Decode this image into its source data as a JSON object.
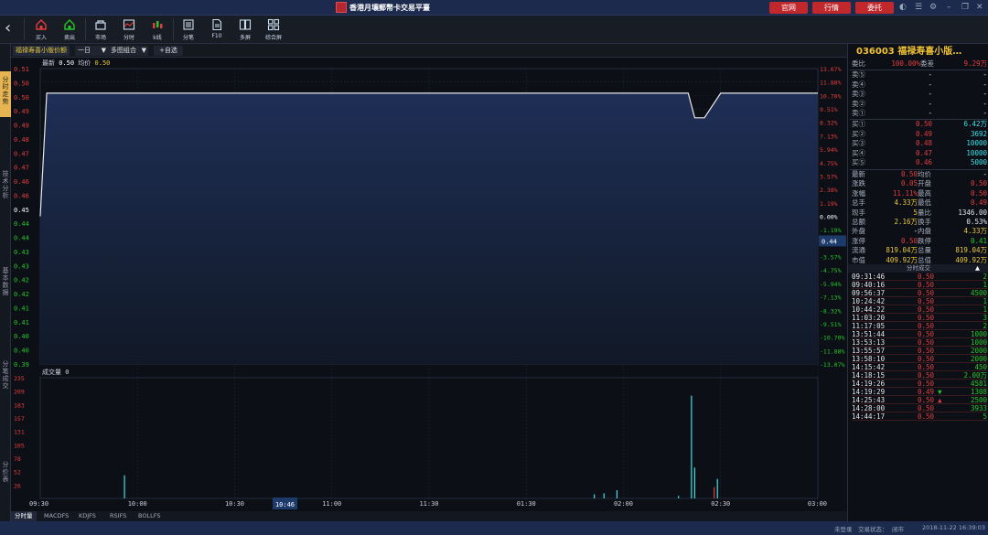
{
  "title": "香港月壤郵幣卡交易平臺",
  "top_buttons": [
    "官网",
    "行情",
    "委托"
  ],
  "toolbar": [
    {
      "label": "买入",
      "icon": "buy-icon"
    },
    {
      "label": "卖出",
      "icon": "sell-icon"
    },
    {
      "label": "市场",
      "icon": "market-icon"
    },
    {
      "label": "分时",
      "icon": "intraday-icon"
    },
    {
      "label": "k线",
      "icon": "kline-icon"
    },
    {
      "label": "分笔",
      "icon": "ticks-icon"
    },
    {
      "label": "F10",
      "icon": "f10-icon"
    },
    {
      "label": "多屏",
      "icon": "multiscreen-icon"
    },
    {
      "label": "综合屏",
      "icon": "overview-icon"
    }
  ],
  "side_tabs": [
    "分时走势",
    "技术分析",
    "基本数据",
    "分笔成交",
    "分价表"
  ],
  "chart_head": {
    "name": "福禄寿喜小版价额",
    "period": "一日",
    "combo": "多图组合",
    "add_fav": "+自选"
  },
  "price_legend": {
    "latest_label": "最新",
    "latest": "0.50",
    "avg_label": "均价",
    "avg": "0.50"
  },
  "volume_legend": {
    "label": "成交量",
    "value": "0"
  },
  "time_cursor": "10:46",
  "bottom_tabs": [
    "分时量",
    "MACDFS",
    "KDJFS",
    "RSIFS",
    "BOLLFS"
  ],
  "status": {
    "login": "未登录",
    "trade_state_label": "交易状态：",
    "trade_state": "闭市",
    "datetime": "2018-11-22 16:39:03"
  },
  "chart_data": {
    "type": "line",
    "prev_close": 0.45,
    "price_axis": [
      "0.51",
      "0.50",
      "0.50",
      "0.49",
      "0.49",
      "0.48",
      "0.47",
      "0.47",
      "0.46",
      "0.46",
      "0.45",
      "0.44",
      "0.44",
      "0.43",
      "0.43",
      "0.42",
      "0.42",
      "0.41",
      "0.41",
      "0.40",
      "0.40",
      "0.39"
    ],
    "pct_axis": [
      "13.07%",
      "11.88%",
      "10.70%",
      "9.51%",
      "8.32%",
      "7.13%",
      "5.94%",
      "4.75%",
      "3.57%",
      "2.38%",
      "1.19%",
      "0.00%",
      "-1.19%",
      "-2.38%",
      "-3.57%",
      "-4.75%",
      "-5.94%",
      "-7.13%",
      "-8.32%",
      "-9.51%",
      "-10.70%",
      "-11.88%",
      "-13.07%"
    ],
    "y_range": [
      0.39,
      0.51
    ],
    "cursor_price": "0.44",
    "x_ticks": [
      "09:30",
      "10:00",
      "10:30",
      "11:00",
      "11:30",
      "01:30",
      "02:00",
      "02:30",
      "03:00"
    ],
    "price_series": {
      "x": [
        0,
        2,
        200,
        202,
        205,
        210,
        240
      ],
      "y": [
        0.45,
        0.5,
        0.5,
        0.49,
        0.49,
        0.5,
        0.5
      ]
    },
    "volume_axis": [
      "235",
      "209",
      "183",
      "157",
      "131",
      "105",
      "78",
      "52",
      "26"
    ],
    "volume_range": [
      0,
      235
    ],
    "volume_bars": [
      {
        "x": 26,
        "v": 45,
        "c": "#3ce0e8"
      },
      {
        "x": 171,
        "v": 8,
        "c": "#3ce0e8"
      },
      {
        "x": 174,
        "v": 10,
        "c": "#3ce0e8"
      },
      {
        "x": 178,
        "v": 16,
        "c": "#3ce0e8"
      },
      {
        "x": 197,
        "v": 5,
        "c": "#3ce0e8"
      },
      {
        "x": 201,
        "v": 200,
        "c": "#3ce0e8"
      },
      {
        "x": 202,
        "v": 60,
        "c": "#3ce0e8"
      },
      {
        "x": 208,
        "v": 22,
        "c": "#e33d3d"
      },
      {
        "x": 209,
        "v": 38,
        "c": "#3ce0e8"
      }
    ]
  },
  "quote": {
    "code": "036003",
    "name": "福禄寿喜小版…",
    "weibi_label": "委比",
    "weibi": "100.00%",
    "weicha_label": "委差",
    "weicha": "9.29万",
    "sells": [
      {
        "label": "卖⑤",
        "price": "-",
        "vol": "-"
      },
      {
        "label": "卖④",
        "price": "-",
        "vol": "-"
      },
      {
        "label": "卖③",
        "price": "-",
        "vol": "-"
      },
      {
        "label": "卖②",
        "price": "-",
        "vol": "-"
      },
      {
        "label": "卖①",
        "price": "-",
        "vol": "-"
      }
    ],
    "buys": [
      {
        "label": "买①",
        "price": "0.50",
        "vol": "6.42万"
      },
      {
        "label": "买②",
        "price": "0.49",
        "vol": "3692"
      },
      {
        "label": "买③",
        "price": "0.48",
        "vol": "10000"
      },
      {
        "label": "买④",
        "price": "0.47",
        "vol": "10000"
      },
      {
        "label": "买⑤",
        "price": "0.46",
        "vol": "5000"
      }
    ],
    "stats": [
      {
        "l1": "最新",
        "v1": "0.50",
        "c1": "red",
        "l2": "均价",
        "v2": "-",
        "c2": "wht"
      },
      {
        "l1": "涨跌",
        "v1": "0.05",
        "c1": "red",
        "l2": "开盘",
        "v2": "0.50",
        "c2": "red"
      },
      {
        "l1": "涨幅",
        "v1": "11.11%",
        "c1": "red",
        "l2": "最高",
        "v2": "0.50",
        "c2": "red"
      },
      {
        "l1": "总手",
        "v1": "4.33万",
        "c1": "yel",
        "l2": "最低",
        "v2": "0.49",
        "c2": "red"
      },
      {
        "l1": "现手",
        "v1": "5",
        "c1": "yel",
        "l2": "量比",
        "v2": "1346.00",
        "c2": "wht"
      },
      {
        "l1": "总额",
        "v1": "2.16万",
        "c1": "yel",
        "l2": "换手",
        "v2": "0.53%",
        "c2": "wht"
      },
      {
        "l1": "外盘",
        "v1": "-",
        "c1": "wht",
        "l2": "内盘",
        "v2": "4.33万",
        "c2": "yel"
      },
      {
        "l1": "涨停",
        "v1": "0.50",
        "c1": "red",
        "l2": "跌停",
        "v2": "0.41",
        "c2": "grn"
      },
      {
        "l1": "流通",
        "v1": "819.04万",
        "c1": "yel",
        "l2": "总量",
        "v2": "819.04万",
        "c2": "yel"
      },
      {
        "l1": "市值",
        "v1": "409.92万",
        "c1": "yel",
        "l2": "总值",
        "v2": "409.92万",
        "c2": "yel"
      }
    ],
    "ticks_header": "分时成交",
    "ticks": [
      {
        "t": "09:31:46",
        "p": "0.50",
        "d": "",
        "v": "2",
        "vc": "grn"
      },
      {
        "t": "09:40:16",
        "p": "0.50",
        "d": "",
        "v": "1",
        "vc": "grn"
      },
      {
        "t": "09:56:37",
        "p": "0.50",
        "d": "",
        "v": "4500",
        "vc": "grn"
      },
      {
        "t": "10:24:42",
        "p": "0.50",
        "d": "",
        "v": "1",
        "vc": "grn"
      },
      {
        "t": "10:44:22",
        "p": "0.50",
        "d": "",
        "v": "1",
        "vc": "grn"
      },
      {
        "t": "11:03:20",
        "p": "0.50",
        "d": "",
        "v": "3",
        "vc": "grn"
      },
      {
        "t": "11:17:05",
        "p": "0.50",
        "d": "",
        "v": "2",
        "vc": "grn"
      },
      {
        "t": "13:51:44",
        "p": "0.50",
        "d": "",
        "v": "1000",
        "vc": "grn"
      },
      {
        "t": "13:53:13",
        "p": "0.50",
        "d": "",
        "v": "1000",
        "vc": "grn"
      },
      {
        "t": "13:55:57",
        "p": "0.50",
        "d": "",
        "v": "2000",
        "vc": "grn"
      },
      {
        "t": "13:58:10",
        "p": "0.50",
        "d": "",
        "v": "2000",
        "vc": "grn"
      },
      {
        "t": "14:15:42",
        "p": "0.50",
        "d": "",
        "v": "450",
        "vc": "grn"
      },
      {
        "t": "14:18:15",
        "p": "0.50",
        "d": "",
        "v": "2.00万",
        "vc": "grn"
      },
      {
        "t": "14:19:26",
        "p": "0.50",
        "d": "",
        "v": "4581",
        "vc": "grn"
      },
      {
        "t": "14:19:29",
        "p": "0.49",
        "d": "▼",
        "v": "1308",
        "vc": "grn"
      },
      {
        "t": "14:25:43",
        "p": "0.50",
        "d": "▲",
        "v": "2500",
        "vc": "grn"
      },
      {
        "t": "14:28:00",
        "p": "0.50",
        "d": "",
        "v": "3933",
        "vc": "grn"
      },
      {
        "t": "14:44:17",
        "p": "0.50",
        "d": "",
        "v": "5",
        "vc": "grn"
      }
    ]
  }
}
